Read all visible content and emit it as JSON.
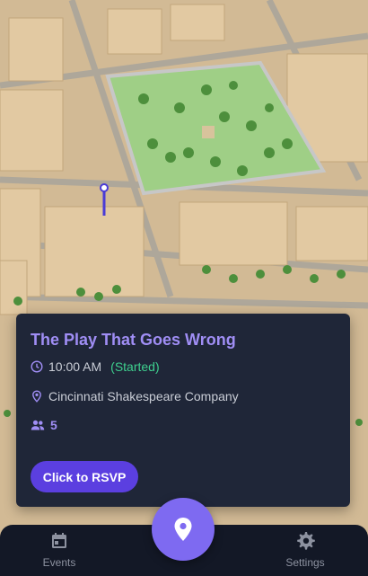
{
  "event": {
    "title": "The Play That Goes Wrong",
    "time": "10:00 AM",
    "status": "(Started)",
    "venue": "Cincinnati Shakespeare Company",
    "attendee_count": "5",
    "rsvp_label": "Click to RSVP"
  },
  "nav": {
    "events_label": "Events",
    "settings_label": "Settings",
    "center_icon": "map-pin-icon"
  },
  "colors": {
    "card_bg": "#1f2638",
    "title": "#a08ef5",
    "status": "#3ecf8e",
    "button": "#5b3fe0",
    "fab": "#7e6af1",
    "nav_bg": "#131826"
  }
}
